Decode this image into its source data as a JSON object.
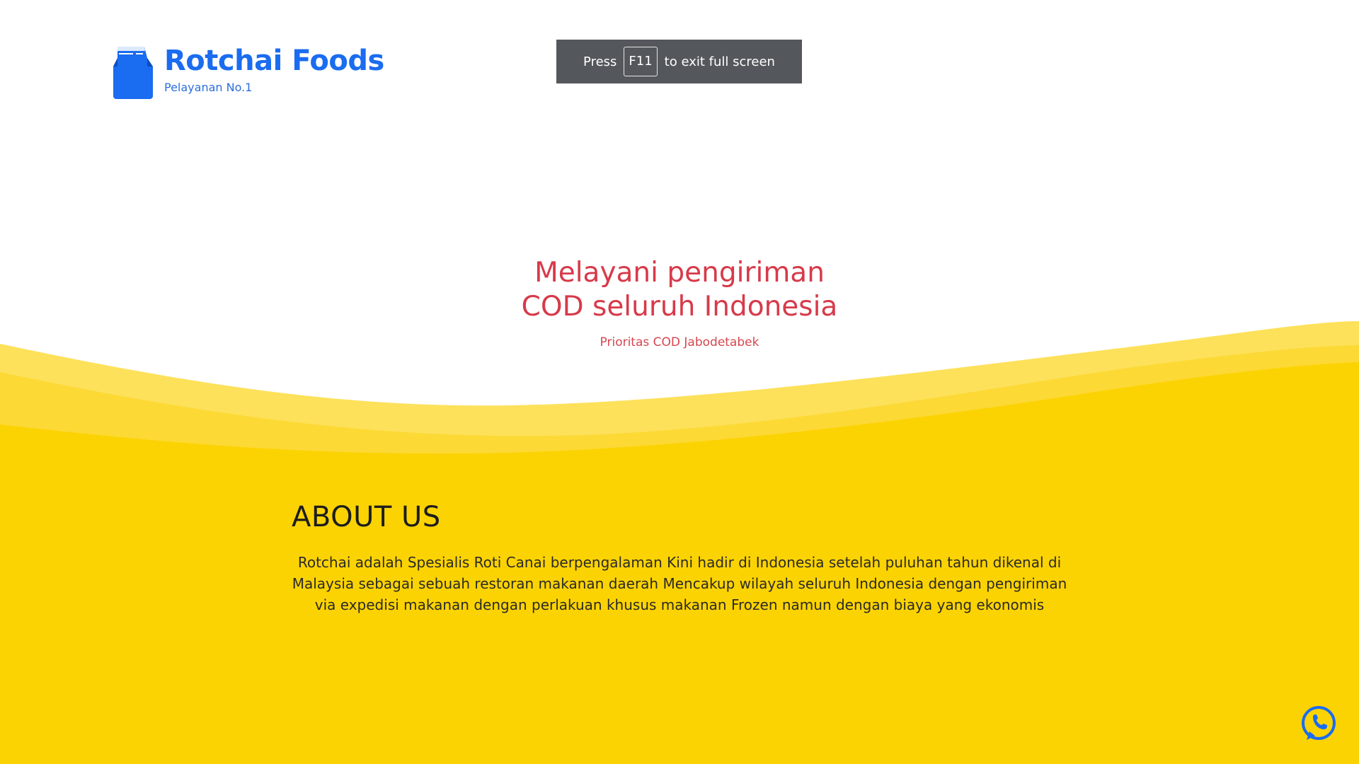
{
  "brand": {
    "title": "Rotchai Foods",
    "subtitle": "Pelayanan No.1",
    "icon": "food-bag-icon",
    "color": "#1a6cf0"
  },
  "fullscreen_toast": {
    "prefix": "Press",
    "key": "F11",
    "suffix": "to exit full screen"
  },
  "hero": {
    "title_line1": "Melayani pengiriman",
    "title_line2": "COD seluruh Indonesia",
    "subtitle": "Prioritas COD Jabodetabek",
    "color": "#d73a4a"
  },
  "about": {
    "title": "ABOUT US",
    "body": "Rotchai adalah Spesialis Roti Canai berpengalaman Kini hadir di Indonesia setelah puluhan tahun dikenal di Malaysia sebagai sebuah restoran makanan daerah Mencakup wilayah seluruh Indonesia dengan pengiriman via expedisi makanan dengan perlakuan khusus makanan Frozen namun dengan biaya yang ekonomis",
    "background_color": "#fcd302"
  },
  "whatsapp": {
    "icon": "whatsapp-icon",
    "color": "#1a6cf0"
  }
}
